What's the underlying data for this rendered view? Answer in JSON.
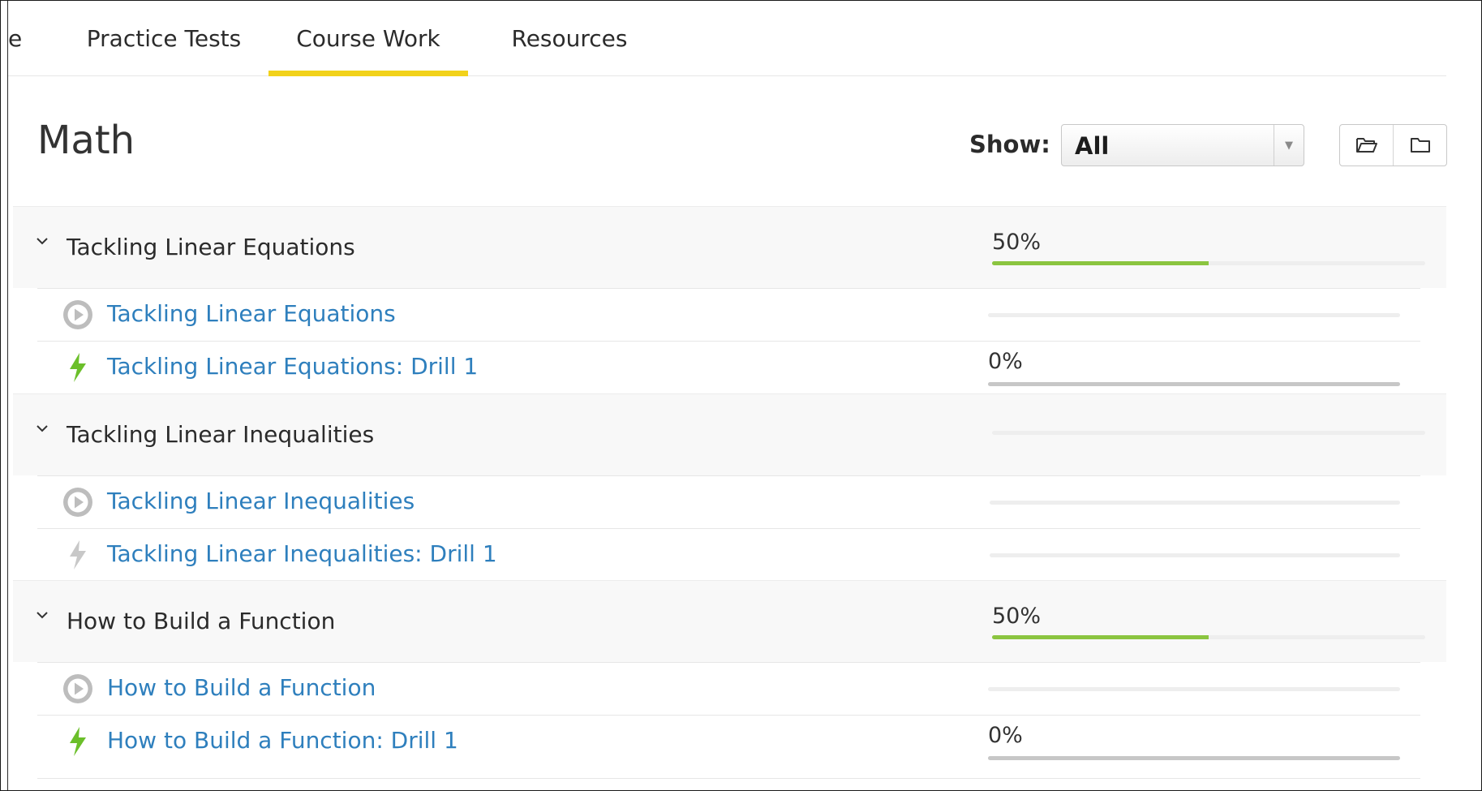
{
  "tabs": [
    {
      "label": "e",
      "active": false
    },
    {
      "label": "Practice Tests",
      "active": false
    },
    {
      "label": "Course Work",
      "active": true
    },
    {
      "label": "Resources",
      "active": false
    }
  ],
  "header": {
    "title": "Math",
    "show_label": "Show:",
    "filter_value": "All"
  },
  "colors": {
    "accent_tab": "#f2d21b",
    "progress_fill": "#8bc540",
    "link": "#2e7fbd",
    "drill_active": "#6bbf2a",
    "drill_inactive": "#c8c8c8"
  },
  "sections": [
    {
      "title": "Tackling Linear Equations",
      "progress_label": "50%",
      "progress": 0.5,
      "items": [
        {
          "type": "video",
          "icon": "play-circle-icon",
          "label": "Tackling Linear Equations",
          "progress_label": "",
          "progress": null
        },
        {
          "type": "drill",
          "icon": "lightning-bolt-icon",
          "active": true,
          "label": "Tackling Linear Equations: Drill 1",
          "progress_label": "0%",
          "progress": 0
        }
      ]
    },
    {
      "title": "Tackling Linear Inequalities",
      "progress_label": "",
      "progress": null,
      "items": [
        {
          "type": "video",
          "icon": "play-circle-icon",
          "label": "Tackling Linear Inequalities",
          "progress_label": "",
          "progress": null
        },
        {
          "type": "drill",
          "icon": "lightning-bolt-icon",
          "active": false,
          "label": "Tackling Linear Inequalities: Drill 1",
          "progress_label": "",
          "progress": null
        }
      ]
    },
    {
      "title": "How to Build a Function",
      "progress_label": "50%",
      "progress": 0.5,
      "items": [
        {
          "type": "video",
          "icon": "play-circle-icon",
          "label": "How to Build a Function",
          "progress_label": "",
          "progress": null
        },
        {
          "type": "drill",
          "icon": "lightning-bolt-icon",
          "active": true,
          "label": "How to Build a Function: Drill 1",
          "progress_label": "0%",
          "progress": 0
        }
      ]
    }
  ]
}
